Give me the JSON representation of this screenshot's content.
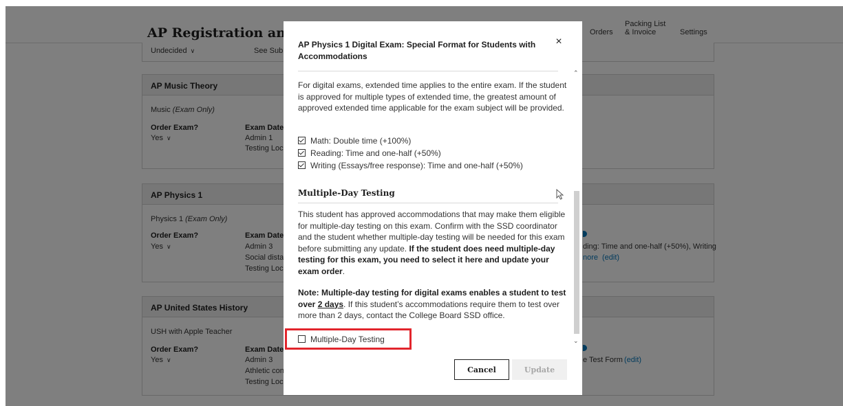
{
  "app": {
    "title": "AP Registration and Ord",
    "nav": {
      "orders": "Orders",
      "packing_line1": "Packing List",
      "packing_line2": "& Invoice",
      "settings": "Settings"
    }
  },
  "background": {
    "top_row": {
      "select": "Undecided",
      "text": "See Submiss"
    },
    "cards": [
      {
        "title": "AP Music Theory",
        "course": "Music",
        "course_note": "(Exam Only)",
        "order_label": "Order Exam?",
        "order_value": "Yes",
        "date_label": "Exam Date",
        "lines": [
          "Admin 1",
          "Testing Loca"
        ]
      },
      {
        "title": "AP Physics 1",
        "course": "Physics 1",
        "course_note": "(Exam Only)",
        "order_label": "Order Exam?",
        "order_value": "Yes",
        "date_label": "Exam Date",
        "lines": [
          "Admin 3",
          "Social distar",
          "Testing Loca"
        ],
        "right_text": "ding: Time and one-half (+50%), Writing",
        "right_more": "nore",
        "right_edit": "(edit)"
      },
      {
        "title": "AP United States History",
        "course": "USH with Apple Teacher",
        "order_label": "Order Exam?",
        "order_value": "Yes",
        "date_label": "Exam Date",
        "lines": [
          "Admin 3",
          "Athletic cont",
          "Testing Loca"
        ],
        "right_text": "e Test Form",
        "right_edit": "(edit)"
      }
    ]
  },
  "modal": {
    "title": "AP Physics 1 Digital Exam: Special Format for Students with Accommodations",
    "close_icon": "×",
    "intro": "For digital exams, extended time applies to the entire exam. If the student is approved for multiple types of extended time, the greatest amount of approved extended time applicable for the exam subject will be provided.",
    "time_items": [
      "Math: Double time (+100%)",
      "Reading: Time and one-half (+50%)",
      "Writing (Essays/free response): Time and one-half (+50%)"
    ],
    "section_title": "Multiple-Day Testing",
    "para1_plain": "This student has approved accommodations that may make them eligible for multiple-day testing on this exam. Confirm with the SSD coordinator and the student whether multiple-day testing will be needed for this exam before submitting any update. ",
    "para1_bold": "If the student does need multiple-day testing for this exam, you need to select it here and update your exam order",
    "para1_end": ".",
    "note_bold_a": "Note: Multiple-day testing for digital exams enables a student to test over ",
    "note_bold_u": "2 days",
    "note_plain": ". If this student’s accommodations require them to test over more than 2 days, contact the College Board SSD office.",
    "checkbox_label": "Multiple-Day Testing",
    "cancel": "Cancel",
    "update": "Update"
  },
  "colors": {
    "accent_link": "#0677ba",
    "highlight": "#e2252c",
    "overlay": "rgba(0,0,0,0.5)"
  }
}
